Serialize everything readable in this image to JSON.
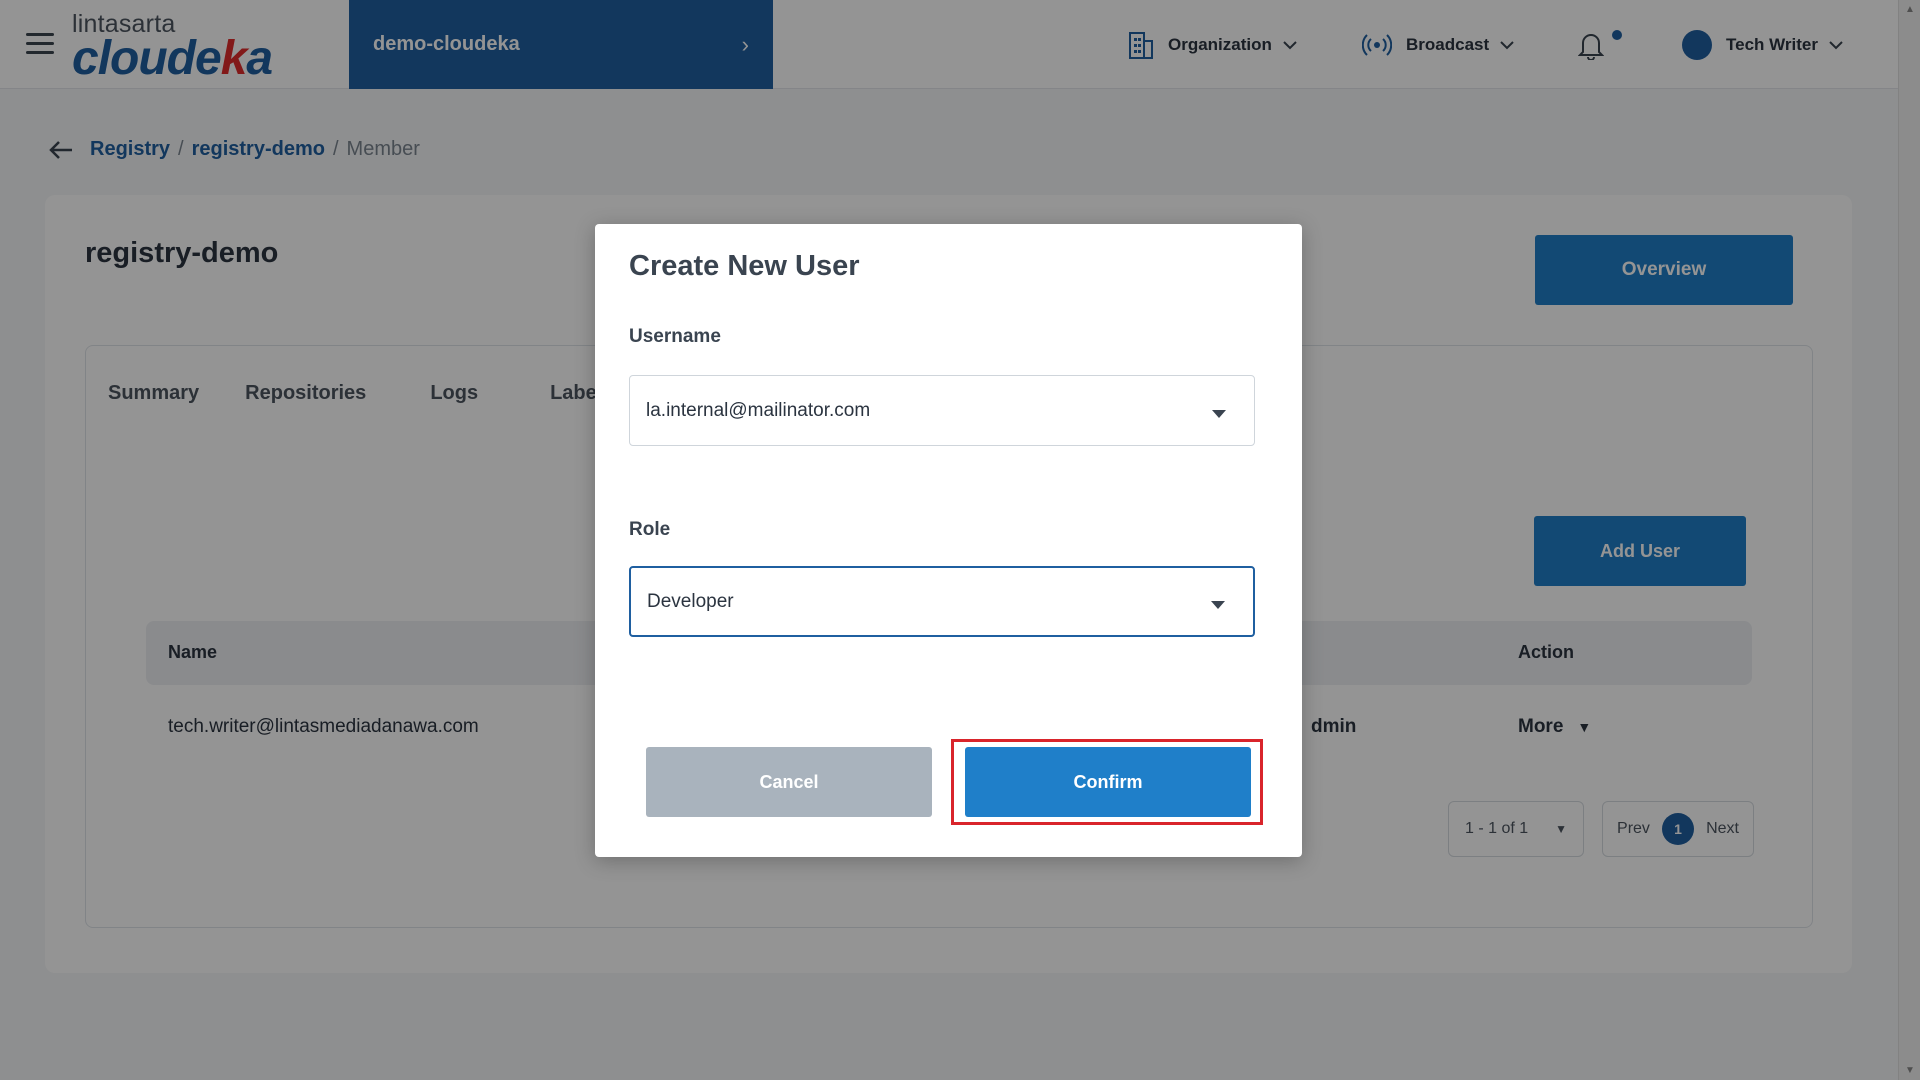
{
  "header": {
    "logo_top": "lintasarta",
    "logo_main_a": "cloude",
    "logo_main_b": "k",
    "logo_main_c": "a",
    "project": "demo-cloudeka",
    "nav": {
      "organization": "Organization",
      "broadcast": "Broadcast",
      "user": "Tech Writer"
    }
  },
  "breadcrumb": {
    "items": [
      "Registry",
      "registry-demo"
    ],
    "separator": "/",
    "current": "Member"
  },
  "card": {
    "title": "registry-demo",
    "overview_label": "Overview",
    "tabs": [
      "Summary",
      "Repositories",
      "Logs",
      "Labe"
    ],
    "add_user_label": "Add User",
    "table": {
      "headers": {
        "name": "Name",
        "action": "Action"
      },
      "rows": [
        {
          "name": "tech.writer@lintasmediadanawa.com",
          "role": "dmin",
          "action": "More"
        }
      ]
    },
    "pagination": {
      "range": "1 - 1 of 1",
      "prev": "Prev",
      "page": "1",
      "next": "Next"
    }
  },
  "modal": {
    "title": "Create New User",
    "username_label": "Username",
    "username_value": "la.internal@mailinator.com",
    "role_label": "Role",
    "role_value": "Developer",
    "cancel_label": "Cancel",
    "confirm_label": "Confirm"
  },
  "colors": {
    "brand": "#1f5fa0",
    "button": "#1f7fc9",
    "highlight": "#d9242b",
    "cancel": "#a9b3bd"
  }
}
